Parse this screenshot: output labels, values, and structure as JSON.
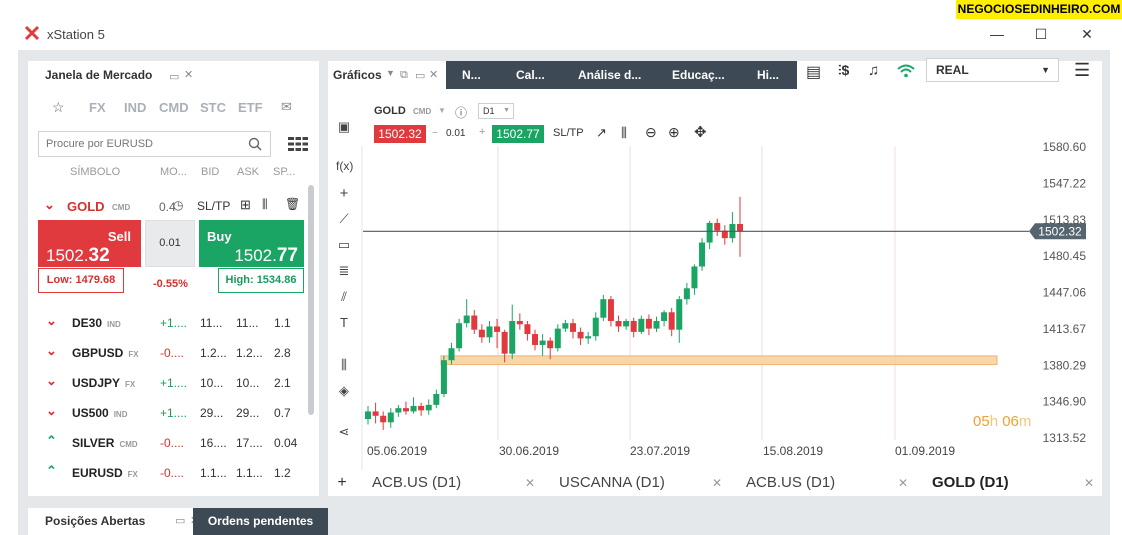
{
  "window": {
    "title": "xStation 5"
  },
  "watermark": "NEGOCIOSEDINHEIRO.COM",
  "market_watch": {
    "title": "Janela de Mercado",
    "categories": [
      "FX",
      "IND",
      "CMD",
      "STC",
      "ETF"
    ],
    "search_placeholder": "Procure por EURUSD",
    "columns": [
      "SÍMBOLO",
      "MO...",
      "BID",
      "ASK",
      "SP..."
    ],
    "selected": {
      "symbol": "GOLD",
      "class": "CMD",
      "mo": "0.4",
      "sltp": "SL/TP",
      "sell_label": "Sell",
      "sell_price_main": "1502.",
      "sell_price_big": "32",
      "buy_label": "Buy",
      "buy_price_main": "1502.",
      "buy_price_big": "77",
      "volume": "0.01",
      "low": "Low: 1479.68",
      "change": "-0.55%",
      "high": "High: 1534.86"
    },
    "rows": [
      {
        "symbol": "DE30",
        "class": "IND",
        "mo": "+1....",
        "bid": "11...",
        "ask": "11...",
        "sp": "1.1",
        "dir": "down"
      },
      {
        "symbol": "GBPUSD",
        "class": "FX",
        "mo": "-0....",
        "bid": "1.2...",
        "ask": "1.2...",
        "sp": "2.8",
        "dir": "down"
      },
      {
        "symbol": "USDJPY",
        "class": "FX",
        "mo": "+1....",
        "bid": "10...",
        "ask": "10...",
        "sp": "2.1",
        "dir": "down"
      },
      {
        "symbol": "US500",
        "class": "IND",
        "mo": "+1....",
        "bid": "29...",
        "ask": "29...",
        "sp": "0.7",
        "dir": "down"
      },
      {
        "symbol": "SILVER",
        "class": "CMD",
        "mo": "-0....",
        "bid": "16....",
        "ask": "17....",
        "sp": "0.04",
        "dir": "up"
      },
      {
        "symbol": "EURUSD",
        "class": "FX",
        "mo": "-0....",
        "bid": "1.1...",
        "ask": "1.1...",
        "sp": "1.2",
        "dir": "up"
      }
    ]
  },
  "chart_toolbar": {
    "graficos": "Gráficos",
    "dark_tabs": [
      "N...",
      "Cal...",
      "Análise d...",
      "Educaç...",
      "Hi..."
    ],
    "account": "REAL"
  },
  "chart_header": {
    "symbol": "GOLD",
    "class": "CMD",
    "interval": "D1",
    "sell_price": "1502.32",
    "volume": "0.01",
    "buy_price": "1502.77",
    "sltp": "SL/TP"
  },
  "countdown": {
    "h": "05",
    "h_unit": "h",
    "m": "06",
    "m_unit": "m"
  },
  "chart_tabs": [
    "ACB.US (D1)",
    "USCANNA (D1)",
    "ACB.US (D1)",
    "GOLD (D1)"
  ],
  "bottom_tabs": [
    "Posições Abertas",
    "Ordens pendentes"
  ],
  "chart_data": {
    "type": "candlestick",
    "title": "GOLD",
    "y_ticks": [
      "1580.60",
      "1547.22",
      "1513.83",
      "1480.45",
      "1447.06",
      "1413.67",
      "1380.29",
      "1346.90",
      "1313.52"
    ],
    "y_range": [
      1313.52,
      1580.6
    ],
    "x_ticks": [
      "05.06.2019",
      "30.06.2019",
      "23.07.2019",
      "15.08.2019",
      "01.09.2019"
    ],
    "current_price": "1502.32",
    "zone": [
      1380,
      1388
    ],
    "candles": [
      [
        1330,
        1337,
        1342,
        1325
      ],
      [
        1337,
        1333,
        1345,
        1326
      ],
      [
        1333,
        1327,
        1337,
        1320
      ],
      [
        1327,
        1336,
        1340,
        1322
      ],
      [
        1336,
        1340,
        1343,
        1332
      ],
      [
        1340,
        1337,
        1346,
        1334
      ],
      [
        1337,
        1342,
        1350,
        1335
      ],
      [
        1342,
        1338,
        1345,
        1333
      ],
      [
        1338,
        1343,
        1348,
        1334
      ],
      [
        1343,
        1353,
        1357,
        1340
      ],
      [
        1353,
        1384,
        1388,
        1350
      ],
      [
        1384,
        1395,
        1400,
        1380
      ],
      [
        1395,
        1418,
        1422,
        1392
      ],
      [
        1418,
        1425,
        1440,
        1414
      ],
      [
        1425,
        1412,
        1430,
        1408
      ],
      [
        1412,
        1405,
        1417,
        1400
      ],
      [
        1405,
        1415,
        1420,
        1400
      ],
      [
        1415,
        1410,
        1422,
        1395
      ],
      [
        1410,
        1390,
        1412,
        1382
      ],
      [
        1390,
        1420,
        1435,
        1385
      ],
      [
        1420,
        1417,
        1427,
        1412
      ],
      [
        1417,
        1408,
        1420,
        1402
      ],
      [
        1408,
        1398,
        1412,
        1393
      ],
      [
        1398,
        1402,
        1408,
        1388
      ],
      [
        1402,
        1395,
        1405,
        1385
      ],
      [
        1395,
        1413,
        1417,
        1392
      ],
      [
        1413,
        1418,
        1421,
        1410
      ],
      [
        1418,
        1410,
        1422,
        1404
      ],
      [
        1410,
        1404,
        1414,
        1398
      ],
      [
        1404,
        1406,
        1410,
        1399
      ],
      [
        1406,
        1423,
        1428,
        1402
      ],
      [
        1423,
        1440,
        1444,
        1420
      ],
      [
        1440,
        1420,
        1443,
        1415
      ],
      [
        1420,
        1415,
        1425,
        1410
      ],
      [
        1415,
        1420,
        1422,
        1412
      ],
      [
        1420,
        1410,
        1423,
        1405
      ],
      [
        1410,
        1422,
        1425,
        1408
      ],
      [
        1422,
        1413,
        1426,
        1407
      ],
      [
        1413,
        1420,
        1424,
        1410
      ],
      [
        1420,
        1428,
        1430,
        1415
      ],
      [
        1428,
        1412,
        1432,
        1406
      ],
      [
        1412,
        1440,
        1443,
        1400
      ],
      [
        1440,
        1450,
        1455,
        1435
      ],
      [
        1450,
        1470,
        1472,
        1444
      ],
      [
        1470,
        1492,
        1496,
        1466
      ],
      [
        1492,
        1510,
        1512,
        1486
      ],
      [
        1510,
        1503,
        1514,
        1498
      ],
      [
        1503,
        1496,
        1508,
        1490
      ],
      [
        1496,
        1509,
        1520,
        1492
      ],
      [
        1509,
        1502.32,
        1534,
        1479
      ]
    ]
  }
}
